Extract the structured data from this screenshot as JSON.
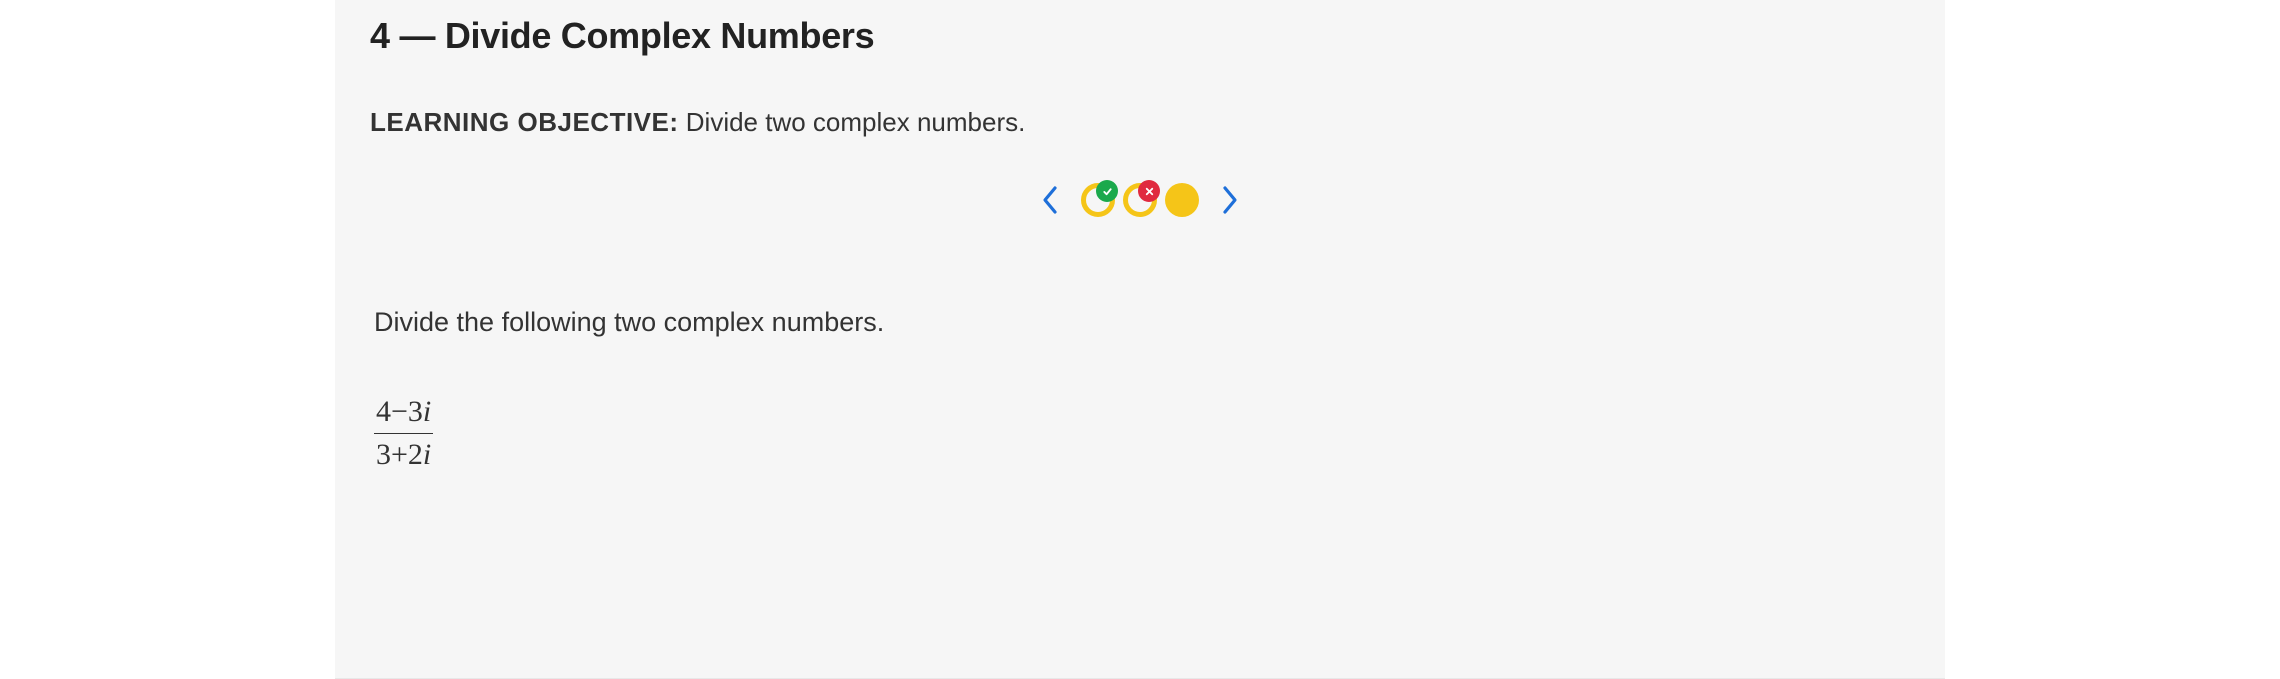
{
  "section": {
    "number": "4",
    "separator": "—",
    "title": "Divide Complex Numbers"
  },
  "learning_objective": {
    "label": "LEARNING OBJECTIVE:",
    "text": "Divide two complex numbers."
  },
  "progress": {
    "items": [
      {
        "state": "ring",
        "badge": "correct"
      },
      {
        "state": "ring",
        "badge": "incorrect"
      },
      {
        "state": "filled",
        "badge": null
      }
    ]
  },
  "question": {
    "prompt": "Divide the following two complex numbers.",
    "fraction": {
      "numerator_a": "4",
      "numerator_op": "−",
      "numerator_b": "3",
      "denominator_a": "3",
      "denominator_op": "+",
      "denominator_b": "2",
      "imag_unit": "i"
    }
  },
  "colors": {
    "chevron": "#1e6fd9",
    "ring": "#f5c518",
    "correct": "#1ba94c",
    "incorrect": "#e02a3f"
  }
}
